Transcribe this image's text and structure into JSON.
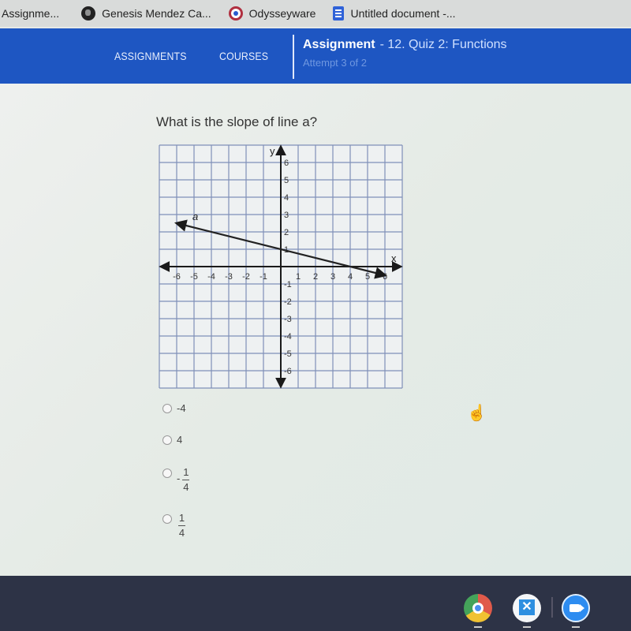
{
  "bookmarks": [
    {
      "label": "Assignme...",
      "icon": "none"
    },
    {
      "label": "Genesis Mendez Ca...",
      "icon": "globe-icon"
    },
    {
      "label": "Odysseyware",
      "icon": "odysseyware-icon"
    },
    {
      "label": "Untitled document -...",
      "icon": "google-docs-icon"
    }
  ],
  "nav": {
    "assignments_label": "ASSIGNMENTS",
    "courses_label": "COURSES",
    "assignment_title": "Assignment",
    "assignment_name": "- 12. Quiz 2: Functions",
    "attempt": "Attempt 3 of 2"
  },
  "colors": {
    "nav_bg": "#1e56c2",
    "grid_line": "#7f8fb8",
    "axis": "#1a1a1a"
  },
  "question": {
    "text": "What is the slope of line a?",
    "line_label": "a"
  },
  "chart_data": {
    "type": "line",
    "title": "",
    "xlabel": "x",
    "ylabel": "y",
    "xlim": [
      -7,
      7
    ],
    "ylim": [
      -7,
      7
    ],
    "grid": true,
    "x_ticks": [
      -6,
      -5,
      -4,
      -3,
      -2,
      -1,
      1,
      2,
      3,
      4,
      5,
      6
    ],
    "y_ticks": [
      6,
      5,
      4,
      3,
      2,
      1,
      -1,
      -2,
      -3,
      -4,
      -5,
      -6
    ],
    "series": [
      {
        "name": "a",
        "points": [
          [
            -6,
            2.5
          ],
          [
            0,
            1
          ],
          [
            4,
            0
          ],
          [
            6,
            -0.5
          ]
        ],
        "arrows": "both"
      }
    ]
  },
  "options": [
    {
      "id": "opt-neg4",
      "text": "-4",
      "type": "plain"
    },
    {
      "id": "opt-4",
      "text": "4",
      "type": "plain"
    },
    {
      "id": "opt-neg-quarter",
      "sign": "-",
      "numerator": "1",
      "denominator": "4",
      "type": "fraction"
    },
    {
      "id": "opt-quarter",
      "sign": "",
      "numerator": "1",
      "denominator": "4",
      "type": "fraction"
    }
  ],
  "shelf": [
    {
      "name": "chrome-app-icon"
    },
    {
      "name": "classroom-app-icon"
    },
    {
      "name": "zoom-app-icon"
    }
  ]
}
